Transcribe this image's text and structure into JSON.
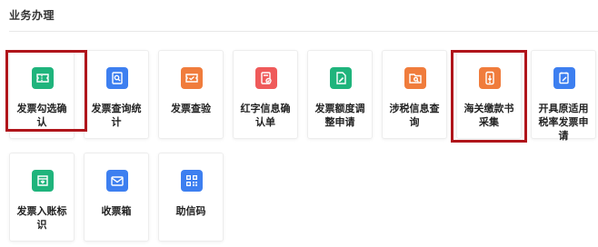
{
  "section": {
    "title": "业务办理"
  },
  "tiles": [
    {
      "label": "发票勾选确认",
      "icon": "ticket-icon",
      "color": "#1fb47c"
    },
    {
      "label": "发票查询统计",
      "icon": "search-document-icon",
      "color": "#3d7ff0"
    },
    {
      "label": "发票查验",
      "icon": "ticket-check-icon",
      "color": "#f07c3c"
    },
    {
      "label": "红字信息确认单",
      "icon": "document-check-icon",
      "color": "#ef5a5a"
    },
    {
      "label": "发票额度调整申请",
      "icon": "edit-document-icon",
      "color": "#1fb47c"
    },
    {
      "label": "涉税信息查询",
      "icon": "folder-search-icon",
      "color": "#f07c3c"
    },
    {
      "label": "海关缴款书采集",
      "icon": "phone-upload-icon",
      "color": "#f07c3c"
    },
    {
      "label": "开具原适用税率发票申请",
      "icon": "pencil-document-icon",
      "color": "#3d7ff0"
    },
    {
      "label": "发票入账标识",
      "icon": "invoice-entry-icon",
      "color": "#1fb47c"
    },
    {
      "label": "收票箱",
      "icon": "mailbox-icon",
      "color": "#3d7ff0"
    },
    {
      "label": "助信码",
      "icon": "qr-code-icon",
      "color": "#3d7ff0"
    }
  ]
}
